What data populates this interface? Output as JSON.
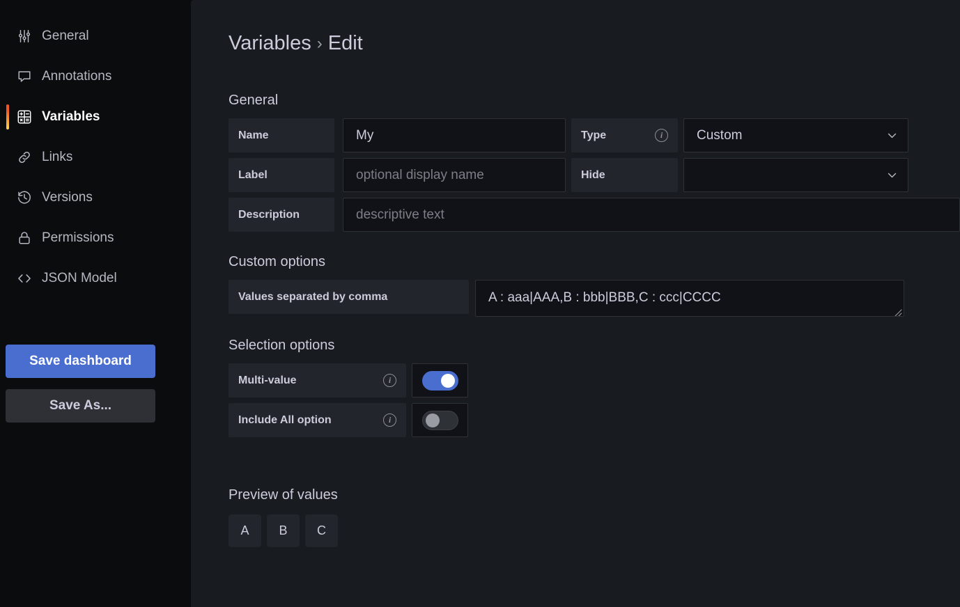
{
  "sidebar": {
    "items": [
      {
        "label": "General",
        "icon": "sliders-icon",
        "active": false
      },
      {
        "label": "Annotations",
        "icon": "comment-icon",
        "active": false
      },
      {
        "label": "Variables",
        "icon": "calculator-icon",
        "active": true
      },
      {
        "label": "Links",
        "icon": "link-icon",
        "active": false
      },
      {
        "label": "Versions",
        "icon": "history-icon",
        "active": false
      },
      {
        "label": "Permissions",
        "icon": "lock-icon",
        "active": false
      },
      {
        "label": "JSON Model",
        "icon": "code-icon",
        "active": false
      }
    ],
    "save_dashboard_label": "Save dashboard",
    "save_as_label": "Save As..."
  },
  "header": {
    "breadcrumb_root": "Variables",
    "breadcrumb_separator": "›",
    "breadcrumb_current": "Edit"
  },
  "general": {
    "section_title": "General",
    "name_label": "Name",
    "name_value": "My",
    "label_label": "Label",
    "label_placeholder": "optional display name",
    "label_value": "",
    "description_label": "Description",
    "description_placeholder": "descriptive text",
    "description_value": "",
    "type_label": "Type",
    "type_value": "Custom",
    "hide_label": "Hide",
    "hide_value": ""
  },
  "custom_options": {
    "section_title": "Custom options",
    "values_label": "Values separated by comma",
    "values_value": "A : aaa|AAA,B : bbb|BBB,C : ccc|CCCC"
  },
  "selection_options": {
    "section_title": "Selection options",
    "multi_value_label": "Multi-value",
    "multi_value_on": true,
    "include_all_label": "Include All option",
    "include_all_on": false
  },
  "preview": {
    "section_title": "Preview of values",
    "values": [
      "A",
      "B",
      "C"
    ]
  },
  "colors": {
    "accent_blue": "#4a6ed0",
    "panel_bg": "#181b1f",
    "app_bg": "#0b0c0e",
    "input_bg": "#111217",
    "label_bg": "#22252b",
    "text": "#ccccdc",
    "active_bar_start": "#f2542a",
    "active_bar_end": "#ffd45e"
  }
}
